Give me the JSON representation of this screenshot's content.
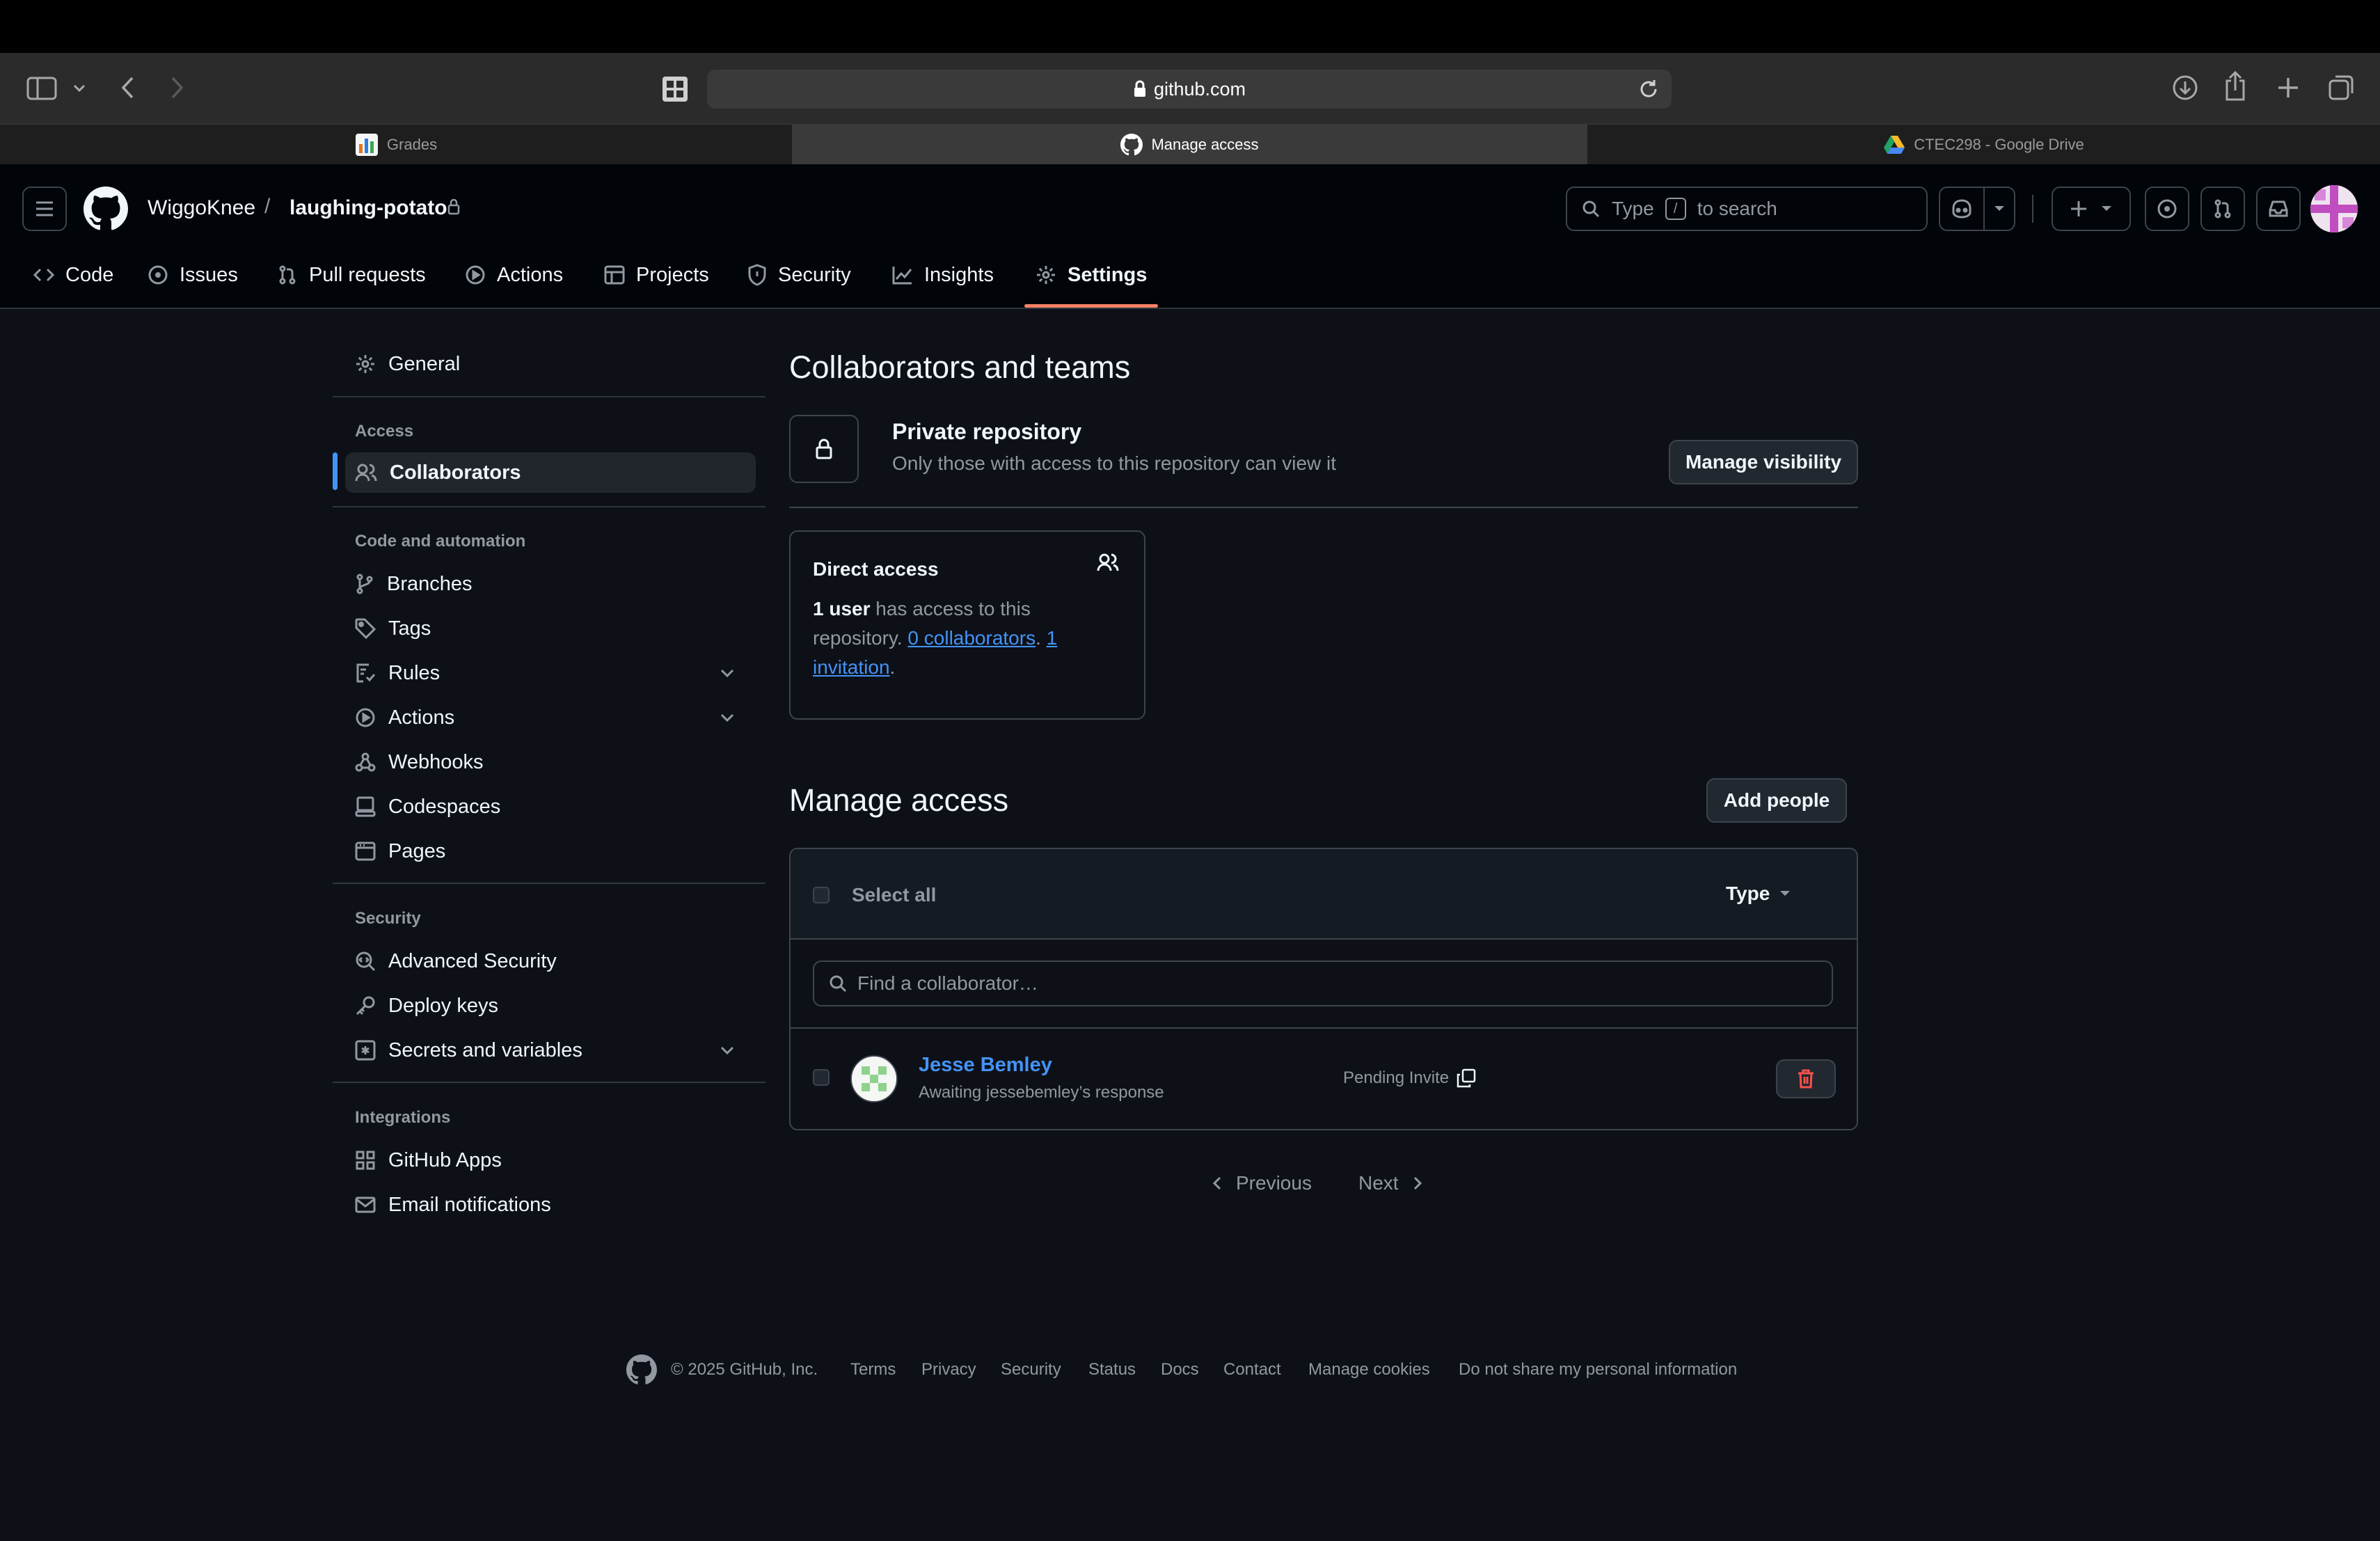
{
  "browser": {
    "url": "github.com",
    "tabs": [
      {
        "label": "Grades",
        "active": false
      },
      {
        "label": "Manage access",
        "active": true
      },
      {
        "label": "CTEC298 - Google Drive",
        "active": false
      }
    ]
  },
  "header": {
    "owner": "WiggoKnee",
    "separator": "/",
    "repo": "laughing-potato",
    "search_prefix": "Type",
    "search_key": "/",
    "search_suffix": "to search"
  },
  "repo_nav": [
    {
      "label": "Code",
      "icon": "code-icon"
    },
    {
      "label": "Issues",
      "icon": "issue-icon"
    },
    {
      "label": "Pull requests",
      "icon": "pull-request-icon"
    },
    {
      "label": "Actions",
      "icon": "play-icon"
    },
    {
      "label": "Projects",
      "icon": "table-icon"
    },
    {
      "label": "Security",
      "icon": "shield-icon"
    },
    {
      "label": "Insights",
      "icon": "graph-icon"
    },
    {
      "label": "Settings",
      "icon": "gear-icon",
      "selected": true
    }
  ],
  "sidebar": {
    "general": "General",
    "sections": [
      {
        "heading": "Access",
        "items": [
          {
            "label": "Collaborators",
            "selected": true
          }
        ]
      },
      {
        "heading": "Code and automation",
        "items": [
          {
            "label": "Branches"
          },
          {
            "label": "Tags"
          },
          {
            "label": "Rules",
            "expandable": true
          },
          {
            "label": "Actions",
            "expandable": true
          },
          {
            "label": "Webhooks"
          },
          {
            "label": "Codespaces"
          },
          {
            "label": "Pages"
          }
        ]
      },
      {
        "heading": "Security",
        "items": [
          {
            "label": "Advanced Security"
          },
          {
            "label": "Deploy keys"
          },
          {
            "label": "Secrets and variables",
            "expandable": true
          }
        ]
      },
      {
        "heading": "Integrations",
        "items": [
          {
            "label": "GitHub Apps"
          },
          {
            "label": "Email notifications"
          }
        ]
      }
    ]
  },
  "main": {
    "title": "Collaborators and teams",
    "visibility": {
      "title": "Private repository",
      "description": "Only those with access to this repository can view it",
      "button": "Manage visibility"
    },
    "direct_access": {
      "title": "Direct access",
      "count_strong": "1 user",
      "text_1": " has access to this repository. ",
      "collaborators_link": "0 collaborators",
      "text_2": ". ",
      "invitation_link": "1 invitation",
      "text_3": "."
    },
    "manage": {
      "title": "Manage access",
      "add_button": "Add people",
      "select_all": "Select all",
      "type_filter": "Type",
      "search_placeholder": "Find a collaborator…",
      "rows": [
        {
          "name": "Jesse Bemley",
          "subtitle": "Awaiting jessebemley’s response",
          "status": "Pending Invite"
        }
      ],
      "pagination": {
        "previous": "Previous",
        "next": "Next"
      }
    }
  },
  "footer": {
    "copyright": "© 2025 GitHub, Inc.",
    "links": [
      "Terms",
      "Privacy",
      "Security",
      "Status",
      "Docs",
      "Contact",
      "Manage cookies",
      "Do not share my personal information"
    ]
  },
  "colors": {
    "background": "#0d1117",
    "header": "#010409",
    "accent_underline": "#f78166",
    "link": "#4493f8",
    "danger": "#f85149",
    "sidebar_indicator": "#4493f8"
  }
}
